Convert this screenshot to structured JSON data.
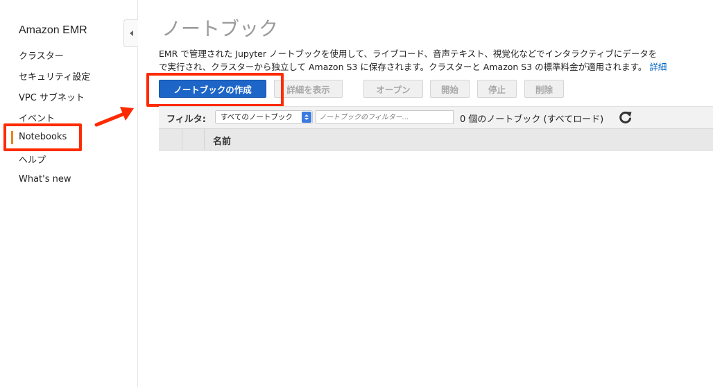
{
  "sidebar": {
    "title": "Amazon EMR",
    "items": [
      {
        "label": "クラスター"
      },
      {
        "label": "セキュリティ設定"
      },
      {
        "label": "VPC サブネット"
      },
      {
        "label": "イベント"
      },
      {
        "label": "Notebooks",
        "active": true
      },
      {
        "label": "ヘルプ"
      },
      {
        "label": "What's new"
      }
    ]
  },
  "page": {
    "title": "ノートブック",
    "description_line1": "EMR で管理された Jupyter ノートブックを使用して、ライブコード、音声テキスト、視覚化などでインタラクティブにデータを",
    "description_line2": "で実行され、クラスターから独立して Amazon S3 に保存されます。クラスターと Amazon S3 の標準料金が適用されます。",
    "description_link": "詳細"
  },
  "toolbar": {
    "create_label": "ノートブックの作成",
    "details_label": "詳細を表示",
    "open_label": "オープン",
    "start_label": "開始",
    "stop_label": "停止",
    "delete_label": "削除"
  },
  "filter": {
    "label": "フィルタ:",
    "selected": "すべてのノートブック",
    "placeholder": "ノートブックのフィルター...",
    "count_text": "0 個のノートブック (すべてロード)"
  },
  "table": {
    "columns": [
      "名前"
    ]
  },
  "colors": {
    "primary": "#1e65c8",
    "annotation": "#ff2a00",
    "active_indicator": "#e8831a",
    "link": "#0066c0"
  }
}
